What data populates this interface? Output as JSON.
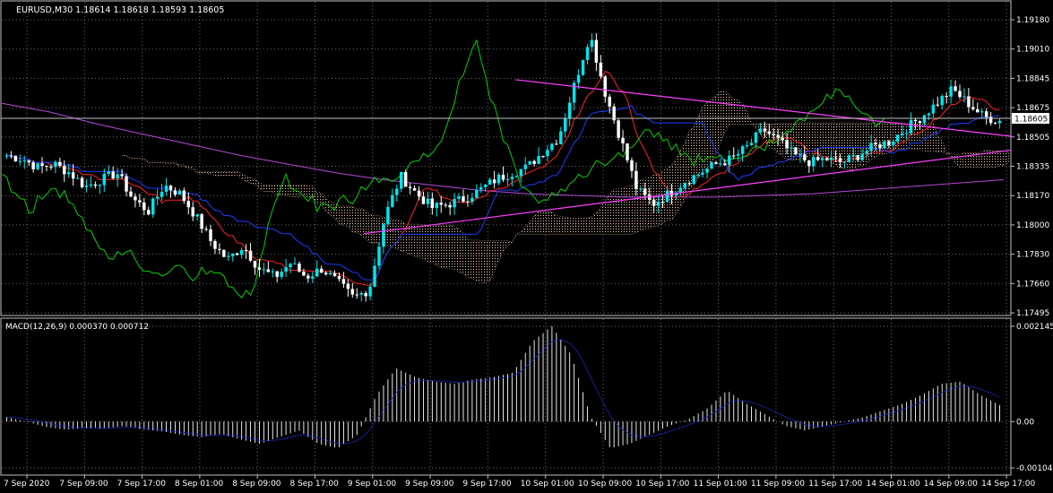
{
  "window": {
    "header": "EURUSD,M30  1.18614 1.18618 1.18593 1.18605"
  },
  "price_panel": {
    "symbol": "EURUSD",
    "timeframe": "M30",
    "ohlc": [
      1.18614,
      1.18618,
      1.18593,
      1.18605
    ],
    "current_price": 1.18605,
    "current_price_label": "1.18605",
    "y_ticks": [
      "1.19180",
      "1.19010",
      "1.18845",
      "1.18675",
      "1.18505",
      "1.18335",
      "1.18170",
      "1.18000",
      "1.17830",
      "1.17660",
      "1.17495"
    ],
    "ylim": [
      1.17495,
      1.1918
    ]
  },
  "macd_panel": {
    "label": "MACD(12,26,9) 0.000370 0.000712",
    "macd": 0.00037,
    "signal": 0.000712,
    "y_ticks": [
      "0.002145",
      "0.00",
      "-0.001043"
    ],
    "ylim": [
      -0.001043,
      0.002145
    ]
  },
  "x_ticks": [
    "7 Sep 2020",
    "7 Sep 09:00",
    "7 Sep 17:00",
    "8 Sep 01:00",
    "8 Sep 09:00",
    "8 Sep 17:00",
    "9 Sep 01:00",
    "9 Sep 09:00",
    "9 Sep 17:00",
    "10 Sep 01:00",
    "10 Sep 09:00",
    "10 Sep 17:00",
    "11 Sep 01:00",
    "11 Sep 09:00",
    "11 Sep 17:00",
    "14 Sep 01:00",
    "14 Sep 09:00",
    "14 Sep 17:00"
  ],
  "colors": {
    "background": "#000000",
    "grid": "#6b6b6b",
    "axis_text": "#ffffff",
    "bull_candle": "#00e5ee",
    "bear_candle": "#ffffff",
    "chikou": "#00d000",
    "tenkan": "#ff2020",
    "kijun": "#1a3cff",
    "kumo": "#f5c8a0",
    "ma": "#b44bd8",
    "trendline": "#ff40ff",
    "macd_hist": "#ffffff",
    "macd_signal": "#1a2fd0"
  },
  "chart_data": {
    "type": "candlestick",
    "x": [
      "7 Sep 2020",
      "7 Sep 09:00",
      "7 Sep 17:00",
      "8 Sep 01:00",
      "8 Sep 09:00",
      "8 Sep 17:00",
      "9 Sep 01:00",
      "9 Sep 09:00",
      "9 Sep 17:00",
      "10 Sep 01:00",
      "10 Sep 09:00",
      "10 Sep 17:00",
      "11 Sep 01:00",
      "11 Sep 09:00",
      "11 Sep 17:00",
      "14 Sep 01:00",
      "14 Sep 09:00",
      "14 Sep 17:00"
    ],
    "close_path": [
      1.184,
      1.1838,
      1.1833,
      1.1835,
      1.183,
      1.1822,
      1.1826,
      1.183,
      1.1815,
      1.1808,
      1.1823,
      1.1818,
      1.1805,
      1.179,
      1.178,
      1.1788,
      1.1775,
      1.177,
      1.1778,
      1.177,
      1.1775,
      1.1767,
      1.1758,
      1.1763,
      1.1805,
      1.1828,
      1.1818,
      1.181,
      1.1812,
      1.1815,
      1.182,
      1.1826,
      1.183,
      1.1833,
      1.1842,
      1.185,
      1.188,
      1.191,
      1.1875,
      1.1848,
      1.182,
      1.1812,
      1.1818,
      1.1825,
      1.183,
      1.1835,
      1.1838,
      1.1845,
      1.1855,
      1.1848,
      1.184,
      1.1836,
      1.1838,
      1.1836,
      1.184,
      1.1845,
      1.1848,
      1.1855,
      1.1862,
      1.187,
      1.1878,
      1.187,
      1.1862,
      1.186
    ],
    "ma_line": [
      1.187,
      1.1865,
      1.1858,
      1.1852,
      1.1846,
      1.184,
      1.1835,
      1.183,
      1.1826,
      1.1823,
      1.182,
      1.1818,
      1.1817,
      1.1816,
      1.1816,
      1.1816,
      1.1817,
      1.1818,
      1.182,
      1.1822,
      1.1824,
      1.1826
    ],
    "macd_hist_path": [
      0.0001,
      0.0,
      -0.00012,
      -0.00018,
      -0.00015,
      -0.00016,
      -0.0001,
      -0.00018,
      -0.00022,
      -0.0003,
      -0.00035,
      -0.00028,
      -0.0004,
      -0.0005,
      -0.00035,
      -0.0002,
      -0.0005,
      -0.0006,
      -0.0003,
      0.0006,
      0.0012,
      0.001,
      0.0009,
      0.00085,
      0.00095,
      0.001,
      0.0011,
      0.0018,
      0.00215,
      0.0015,
      0.0001,
      -0.0006,
      -0.0005,
      -0.0003,
      -0.0001,
      5e-05,
      0.0003,
      0.0007,
      0.0004,
      0.00015,
      -0.0001,
      -0.0002,
      -0.0001,
      0.0,
      0.0001,
      0.00025,
      0.0004,
      0.0006,
      0.00085,
      0.0009,
      0.0006,
      0.00037
    ],
    "trendline_upper": [
      [
        1.18835,
        0.51
      ],
      [
        1.1851,
        1.0
      ]
    ],
    "trendline_lower": [
      [
        1.1795,
        0.36
      ],
      [
        1.1843,
        1.0
      ]
    ]
  }
}
